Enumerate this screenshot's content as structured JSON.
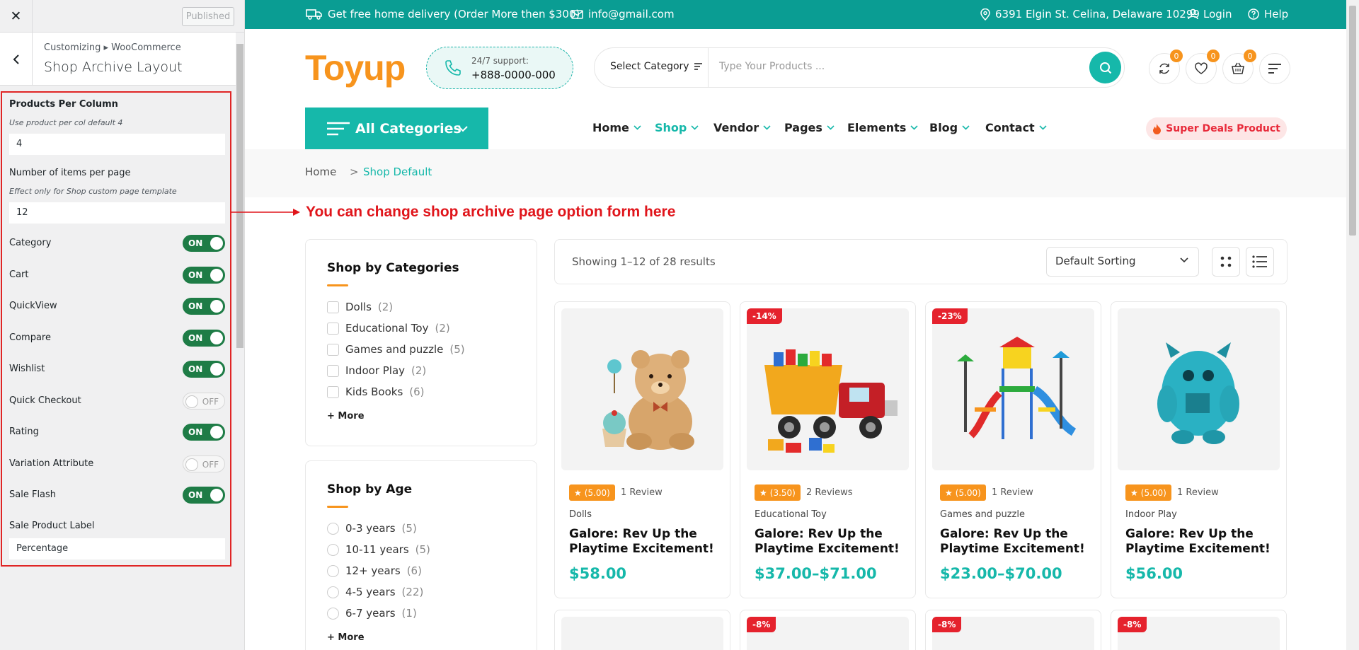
{
  "customizer": {
    "close_label": "✕",
    "publish_label": "Published",
    "breadcrumb": "Customizing ▸ WooCommerce",
    "section_title": "Shop Archive Layout",
    "products_per_column": {
      "label": "Products Per Column",
      "desc": "Use product per col default 4",
      "value": "4"
    },
    "items_per_page": {
      "label": "Number of items per page",
      "desc": "Effect only for Shop custom page template",
      "value": "12"
    },
    "toggles": [
      {
        "label": "Category",
        "state": "ON"
      },
      {
        "label": "Cart",
        "state": "ON"
      },
      {
        "label": "QuickView",
        "state": "ON"
      },
      {
        "label": "Compare",
        "state": "ON"
      },
      {
        "label": "Wishlist",
        "state": "ON"
      },
      {
        "label": "Quick Checkout",
        "state": "OFF"
      },
      {
        "label": "Rating",
        "state": "ON"
      },
      {
        "label": "Variation Attribute",
        "state": "OFF"
      },
      {
        "label": "Sale Flash",
        "state": "ON"
      }
    ],
    "sale_label": {
      "label": "Sale Product Label",
      "value": "Percentage"
    }
  },
  "topbar": {
    "delivery": "Get free home delivery (Order More then $300)",
    "email": "info@gmail.com",
    "address": "6391 Elgin St. Celina, Delaware 10299",
    "login": "Login",
    "help": "Help"
  },
  "header": {
    "logo": "Toyup",
    "support_line1": "24/7 support:",
    "support_line2": "+888-0000-000",
    "select_category": "Select Category",
    "search_placeholder": "Type Your Products ...",
    "badges": {
      "compare": "0",
      "wishlist": "0",
      "cart": "0"
    }
  },
  "nav": {
    "all_categories": "All Categories",
    "items": [
      "Home",
      "Shop",
      "Vendor",
      "Pages",
      "Elements",
      "Blog",
      "Contact"
    ],
    "deals": "Super Deals Product"
  },
  "breadcrumb": {
    "home": "Home",
    "separator": ">",
    "current": "Shop Default"
  },
  "annotation": "You can change shop archive page option form here",
  "categories": {
    "title": "Shop by Categories",
    "items": [
      {
        "name": "Dolls",
        "count": "(2)"
      },
      {
        "name": "Educational Toy",
        "count": "(2)"
      },
      {
        "name": "Games and puzzle",
        "count": "(5)"
      },
      {
        "name": "Indoor Play",
        "count": "(2)"
      },
      {
        "name": "Kids Books",
        "count": "(6)"
      }
    ],
    "more": "+ More"
  },
  "ages": {
    "title": "Shop by Age",
    "items": [
      {
        "name": "0-3 years",
        "count": "(5)"
      },
      {
        "name": "10-11 years",
        "count": "(5)"
      },
      {
        "name": "12+ years",
        "count": "(6)"
      },
      {
        "name": "4-5 years",
        "count": "(22)"
      },
      {
        "name": "6-7 years",
        "count": "(1)"
      }
    ],
    "more": "+ More"
  },
  "toolbar": {
    "results": "Showing 1–12 of 28 results",
    "sort": "Default Sorting"
  },
  "products": [
    {
      "sale": "",
      "rating": "(5.00)",
      "reviews": "1 Review",
      "category": "Dolls",
      "title": "Galore: Rev Up the Playtime Excitement!",
      "price": "$58.00",
      "image": "teddy-bear-image"
    },
    {
      "sale": "-14%",
      "rating": "(3.50)",
      "reviews": "2 Reviews",
      "category": "Educational Toy",
      "title": "Galore: Rev Up the Playtime Excitement!",
      "price": "$37.00–$71.00",
      "image": "dump-truck-image"
    },
    {
      "sale": "-23%",
      "rating": "(5.00)",
      "reviews": "1 Review",
      "category": "Games and puzzle",
      "title": "Galore: Rev Up the Playtime Excitement!",
      "price": "$23.00–$70.00",
      "image": "playground-image"
    },
    {
      "sale": "",
      "rating": "(5.00)",
      "reviews": "1 Review",
      "category": "Indoor Play",
      "title": "Galore: Rev Up the Playtime Excitement!",
      "price": "$56.00",
      "image": "blue-monster-plush-image"
    }
  ],
  "next_row_sales": [
    "",
    "-8%",
    "-8%",
    "-8%"
  ],
  "colors": {
    "teal": "#0a9d93",
    "accent": "#16b8aa",
    "orange": "#f7941d",
    "red": "#e5222d",
    "toggle_on": "#1e7c46"
  }
}
